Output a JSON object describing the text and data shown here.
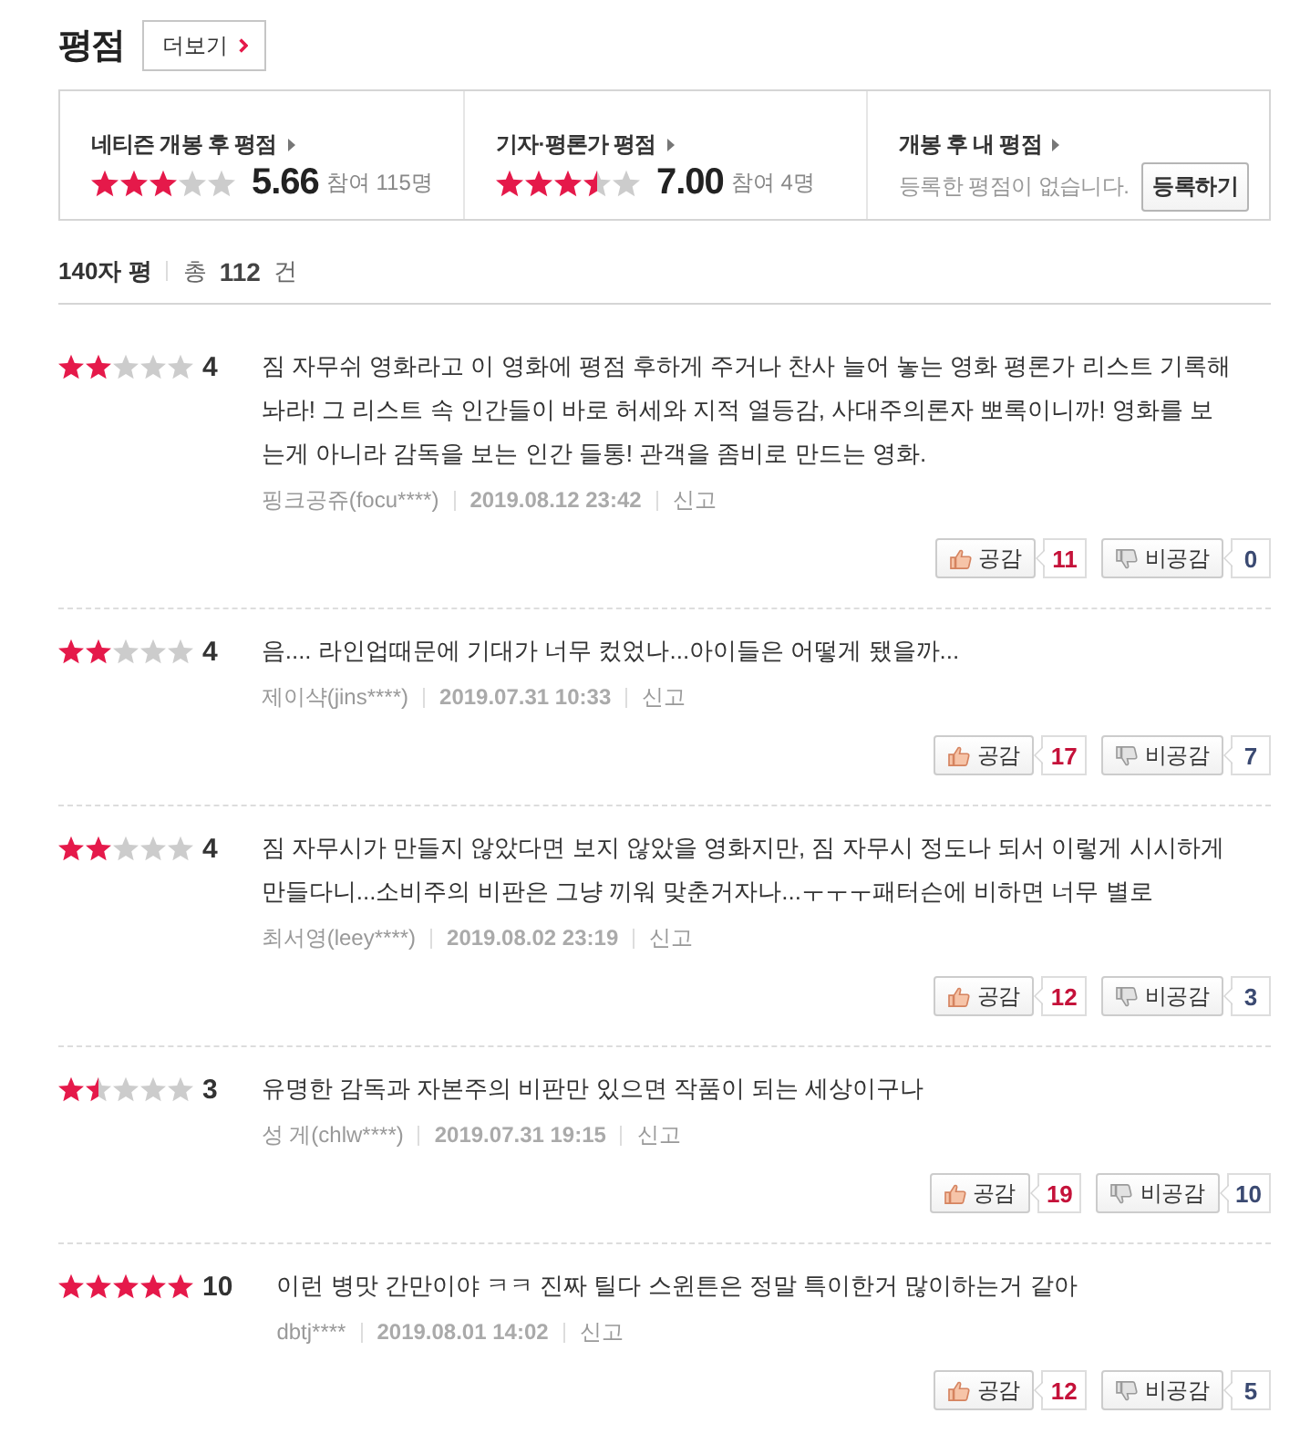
{
  "section": {
    "title": "평점",
    "more_button": "더보기"
  },
  "rating_summary": [
    {
      "kind": "score",
      "title": "네티즌 개봉 후 평점",
      "stars": 3,
      "score": "5.66",
      "participants": "참여 115명"
    },
    {
      "kind": "score",
      "title": "기자·평론가 평점",
      "stars": 3.5,
      "score": "7.00",
      "participants": "참여 4명"
    },
    {
      "kind": "mine",
      "title": "개봉 후 내 평점",
      "message": "등록한 평점이 없습니다.",
      "button": "등록하기"
    }
  ],
  "review_header": {
    "label": "140자 평",
    "total_prefix": "총",
    "total_count": "112",
    "total_suffix": "건"
  },
  "reviews": [
    {
      "stars": 2,
      "score": "4",
      "text": "짐 자무쉬 영화라고 이 영화에 평점 후하게 주거나 찬사 늘어 놓는 영화 평론가 리스트 기록해 놔라! 그 리스트 속 인간들이 바로 허세와 지적 열등감, 사대주의론자 뽀록이니까! 영화를 보는게 아니라 감독을 보는 인간 들통! 관객을 좀비로 만드는 영화.",
      "author": "핑크공쥬(focu****)",
      "date": "2019.08.12 23:42",
      "report": "신고",
      "agree_label": "공감",
      "agree_count": "11",
      "disagree_label": "비공감",
      "disagree_count": "0"
    },
    {
      "stars": 2,
      "score": "4",
      "text": "음.... 라인업때문에 기대가 너무 컸었나...아이들은 어떻게 됐을까...",
      "author": "제이샥(jins****)",
      "date": "2019.07.31 10:33",
      "report": "신고",
      "agree_label": "공감",
      "agree_count": "17",
      "disagree_label": "비공감",
      "disagree_count": "7"
    },
    {
      "stars": 2,
      "score": "4",
      "text": "짐 자무시가 만들지 않았다면 보지 않았을 영화지만, 짐 자무시 정도나 되서 이렇게 시시하게 만들다니...소비주의 비판은 그냥 끼워 맞춘거자나...ㅜㅜㅜ패터슨에 비하면 너무 별로",
      "author": "최서영(leey****)",
      "date": "2019.08.02 23:19",
      "report": "신고",
      "agree_label": "공감",
      "agree_count": "12",
      "disagree_label": "비공감",
      "disagree_count": "3"
    },
    {
      "stars": 1.5,
      "score": "3",
      "text": "유명한 감독과 자본주의 비판만 있으면 작품이 되는 세상이구나",
      "author": "성 게(chlw****)",
      "date": "2019.07.31 19:15",
      "report": "신고",
      "agree_label": "공감",
      "agree_count": "19",
      "disagree_label": "비공감",
      "disagree_count": "10"
    },
    {
      "stars": 5,
      "score": "10",
      "text": "이런 병맛 간만이야 ㅋㅋ 진짜 틸다 스윈튼은 정말 특이한거 많이하는거 같아",
      "author": "dbtj****",
      "date": "2019.08.01 14:02",
      "report": "신고",
      "agree_label": "공감",
      "agree_count": "12",
      "disagree_label": "비공감",
      "disagree_count": "5"
    }
  ]
}
